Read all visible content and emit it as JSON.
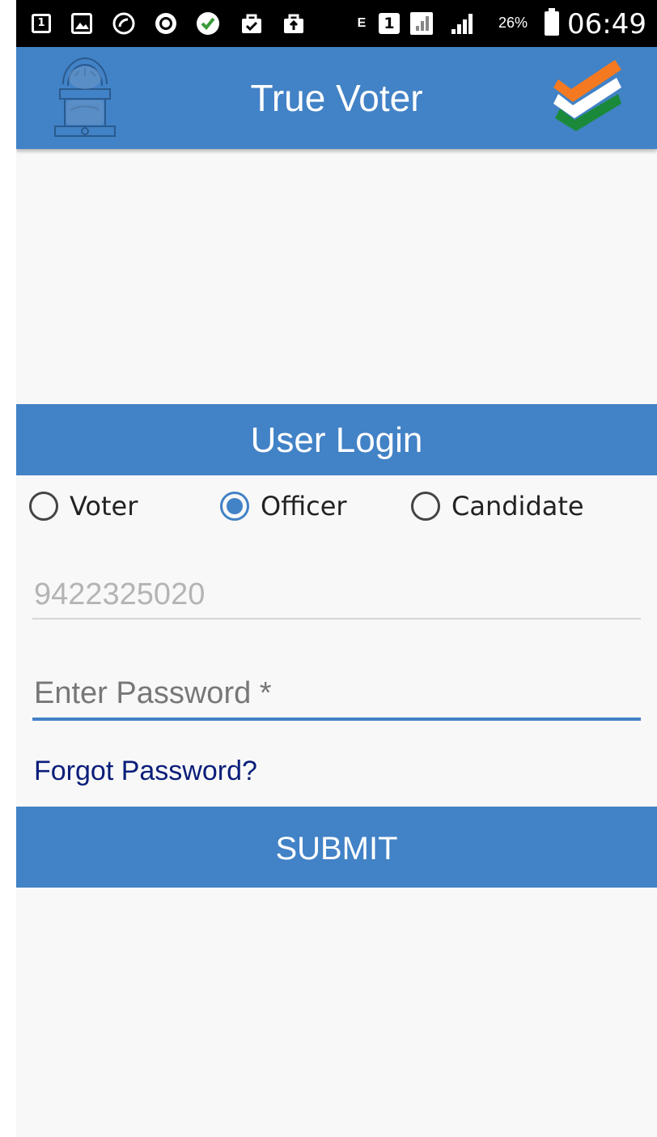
{
  "status_bar": {
    "battery": "26%",
    "time": "06:49",
    "sim_label": "1",
    "network_label": "E"
  },
  "app_bar": {
    "title": "True Voter",
    "emblem_icon": "national-emblem-icon",
    "logo_icon": "tricolor-check-logo"
  },
  "login": {
    "header": "User Login",
    "roles": [
      {
        "label": "Voter",
        "checked": false
      },
      {
        "label": "Officer",
        "checked": true
      },
      {
        "label": "Candidate",
        "checked": false
      }
    ],
    "mobile_placeholder": "9422325020",
    "password_placeholder": "Enter Password *",
    "forgot_label": "Forgot Password?",
    "submit_label": "SUBMIT"
  },
  "colors": {
    "primary": "#4282c6",
    "link": "#0a1e7a",
    "background": "#f8f8f8"
  }
}
